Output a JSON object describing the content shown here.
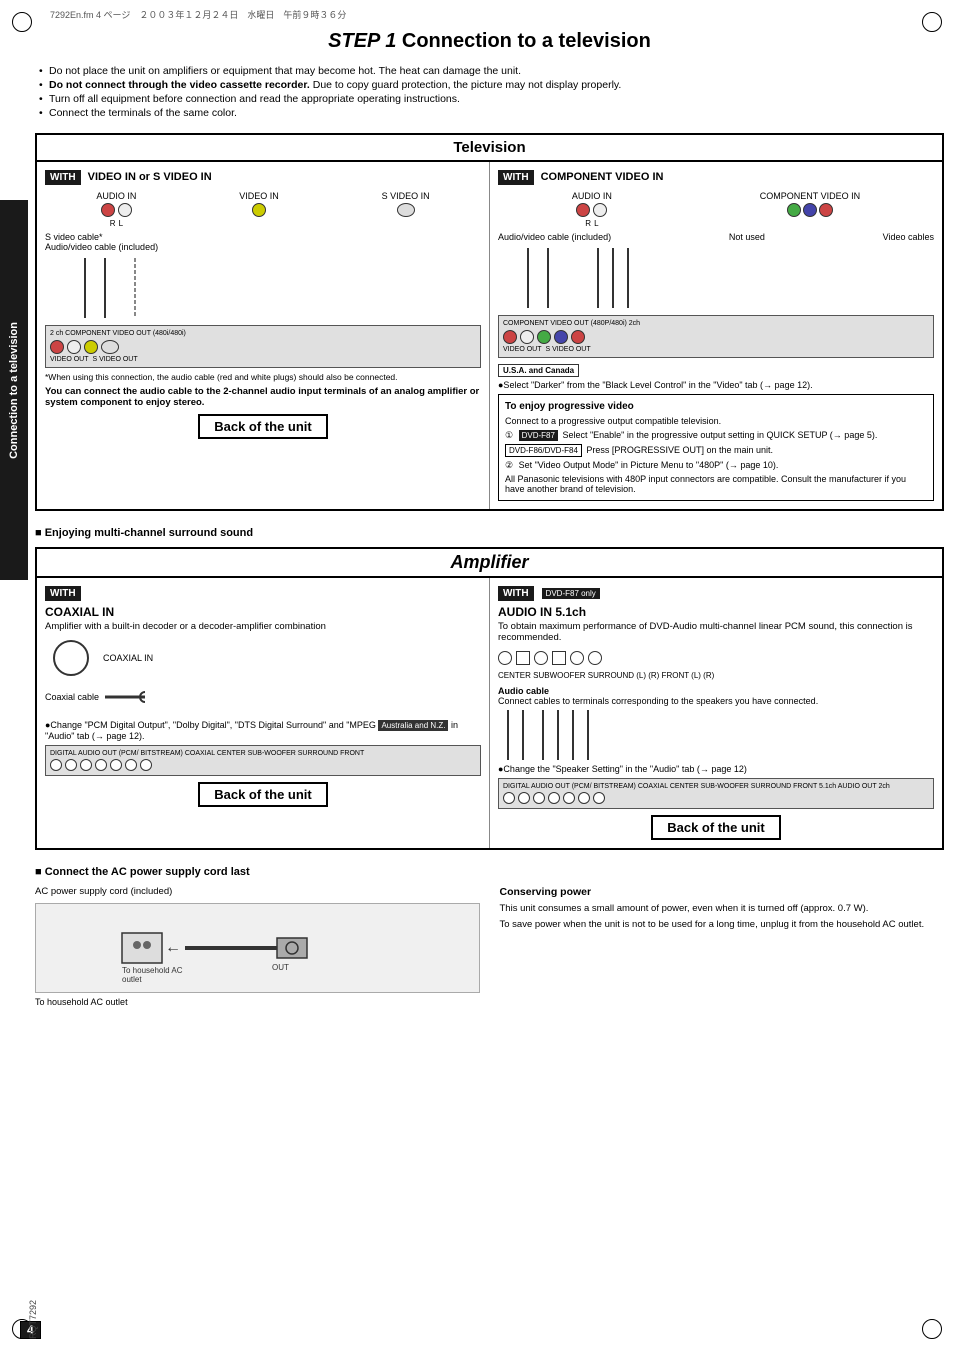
{
  "page": {
    "file_info": "7292En.fm  4 ページ　２００３年１２月２４日　水曜日　午前９時３６分",
    "page_number": "4",
    "part_number": "RQT7292",
    "sidebar_label": "Connection to a television"
  },
  "step1": {
    "title": "STEP 1",
    "title_suffix": " Connection to a television"
  },
  "bullets": [
    "Do not place the unit on amplifiers or equipment that may become hot. The heat can damage the unit.",
    "Do not connect through the video cassette recorder. Due to copy guard protection, the picture may not display properly.",
    "Turn off all equipment before connection and read the appropriate operating instructions.",
    "Connect the terminals of the same color."
  ],
  "television": {
    "header": "Television",
    "with_label_left": "WITH",
    "left_label": "VIDEO IN or S VIDEO IN",
    "with_label_right": "WITH",
    "right_label": "COMPONENT VIDEO IN",
    "left_inputs": {
      "audio_in": "AUDIO IN",
      "audio_r": "R",
      "audio_l": "L",
      "video_in": "VIDEO IN",
      "s_video_in": "S VIDEO IN"
    },
    "right_inputs": {
      "audio_in": "AUDIO IN",
      "audio_r": "R",
      "audio_l": "L",
      "component_video_in": "COMPONENT VIDEO IN"
    },
    "s_video_cable": "S video cable*",
    "audio_video_cable_left": "Audio/video cable (included)",
    "audio_video_cable_right": "Audio/video cable (included)",
    "not_used": "Not used",
    "video_cables": "Video cables",
    "back_of_unit": "Back of the unit",
    "footnote": "*When using this connection, the audio cable (red and white plugs) should also be connected.",
    "stereo_note": "You can connect the audio cable to the 2-channel audio input terminals of an analog amplifier or system component to enjoy stereo.",
    "usa_canada": {
      "badge": "U.S.A. and Canada",
      "text": "●Select \"Darker\" from the \"Black Level Control\" in the \"Video\" tab (→ page 12)."
    },
    "unit_left_labels": "2 ch  COMPONENT  VIDEO OUT (480i/480i)",
    "unit_right_labels": "COMPONENT VIDEO OUT (480P/480i) 2ch",
    "video_out": "VIDEO OUT",
    "s_video_out": "S VIDEO OUT"
  },
  "progressive_video": {
    "title": "To enjoy progressive video",
    "intro": "Connect to a progressive output compatible television.",
    "dvd_f87_badge": "DVD-F87",
    "step1_text": "Select \"Enable\" in the progressive output setting in QUICK SETUP (→ page 5).",
    "dvd_f8684_badge": "DVD-F86/DVD-F84",
    "step2_text": "Press [PROGRESSIVE OUT] on the main unit.",
    "step2b_text": "Set \"Video Output Mode\" in Picture Menu to \"480P\" (→ page 10).",
    "note": "All Panasonic televisions with 480P input connectors are compatible. Consult the manufacturer if you have another brand of television."
  },
  "multi_channel": {
    "section_title": "Enjoying multi-channel surround sound",
    "amplifier_header": "Amplifier",
    "dvd_only": "DVD-F87 only",
    "left": {
      "with_badge": "WITH",
      "label": "COAXIAL IN",
      "sub_label": "Amplifier with a built-in decoder or a decoder-amplifier combination",
      "coaxial_in_label": "COAXIAL IN",
      "coaxial_cable_label": "Coaxial cable",
      "australia_badge": "Australia and N.Z.",
      "change_text": "●Change \"PCM Digital Output\", \"Dolby Digital\", \"DTS Digital Surround\" and \"MPEG",
      "audio_tab": " in \"Audio\" tab (→ page 12).",
      "back_of_unit": "Back of the unit",
      "unit_labels": "DIGITAL AUDIO OUT (PCM/ BITSTREAM) COAXIAL CENTER SUB-WOOFER SURROUND FRONT"
    },
    "right": {
      "with_badge": "WITH",
      "label": "AUDIO IN 5.1ch",
      "sub_label": "To obtain maximum performance of DVD-Audio multi-channel linear PCM sound, this connection is recommended.",
      "audio_cable_label": "Audio cable",
      "audio_cable_desc": "Connect cables to terminals corresponding to the speakers you have connected.",
      "change_text": "●Change the \"Speaker Setting\" in the \"Audio\" tab (→ page 12)",
      "back_of_unit": "Back of the unit",
      "port_labels": "CENTER SUBWOOFER SURROUND (L) (R) FRONT (L) (R)",
      "unit_labels": "DIGITAL AUDIO OUT (PCM/ BITSTREAM) COAXIAL CENTER SUB-WOOFER SURROUND FRONT 5.1ch AUDIO OUT 2ch"
    }
  },
  "ac_power": {
    "section_title": "Connect the AC power supply cord last",
    "cord_label": "AC power supply cord (included)",
    "outlet_label": "To household AC outlet",
    "conserving_title": "Conserving power",
    "conserving_text1": "This unit consumes a small amount of power, even when it is turned off (approx. 0.7 W).",
    "conserving_text2": "To save power when the unit is not to be used for a long time, unplug it from the household AC outlet."
  }
}
